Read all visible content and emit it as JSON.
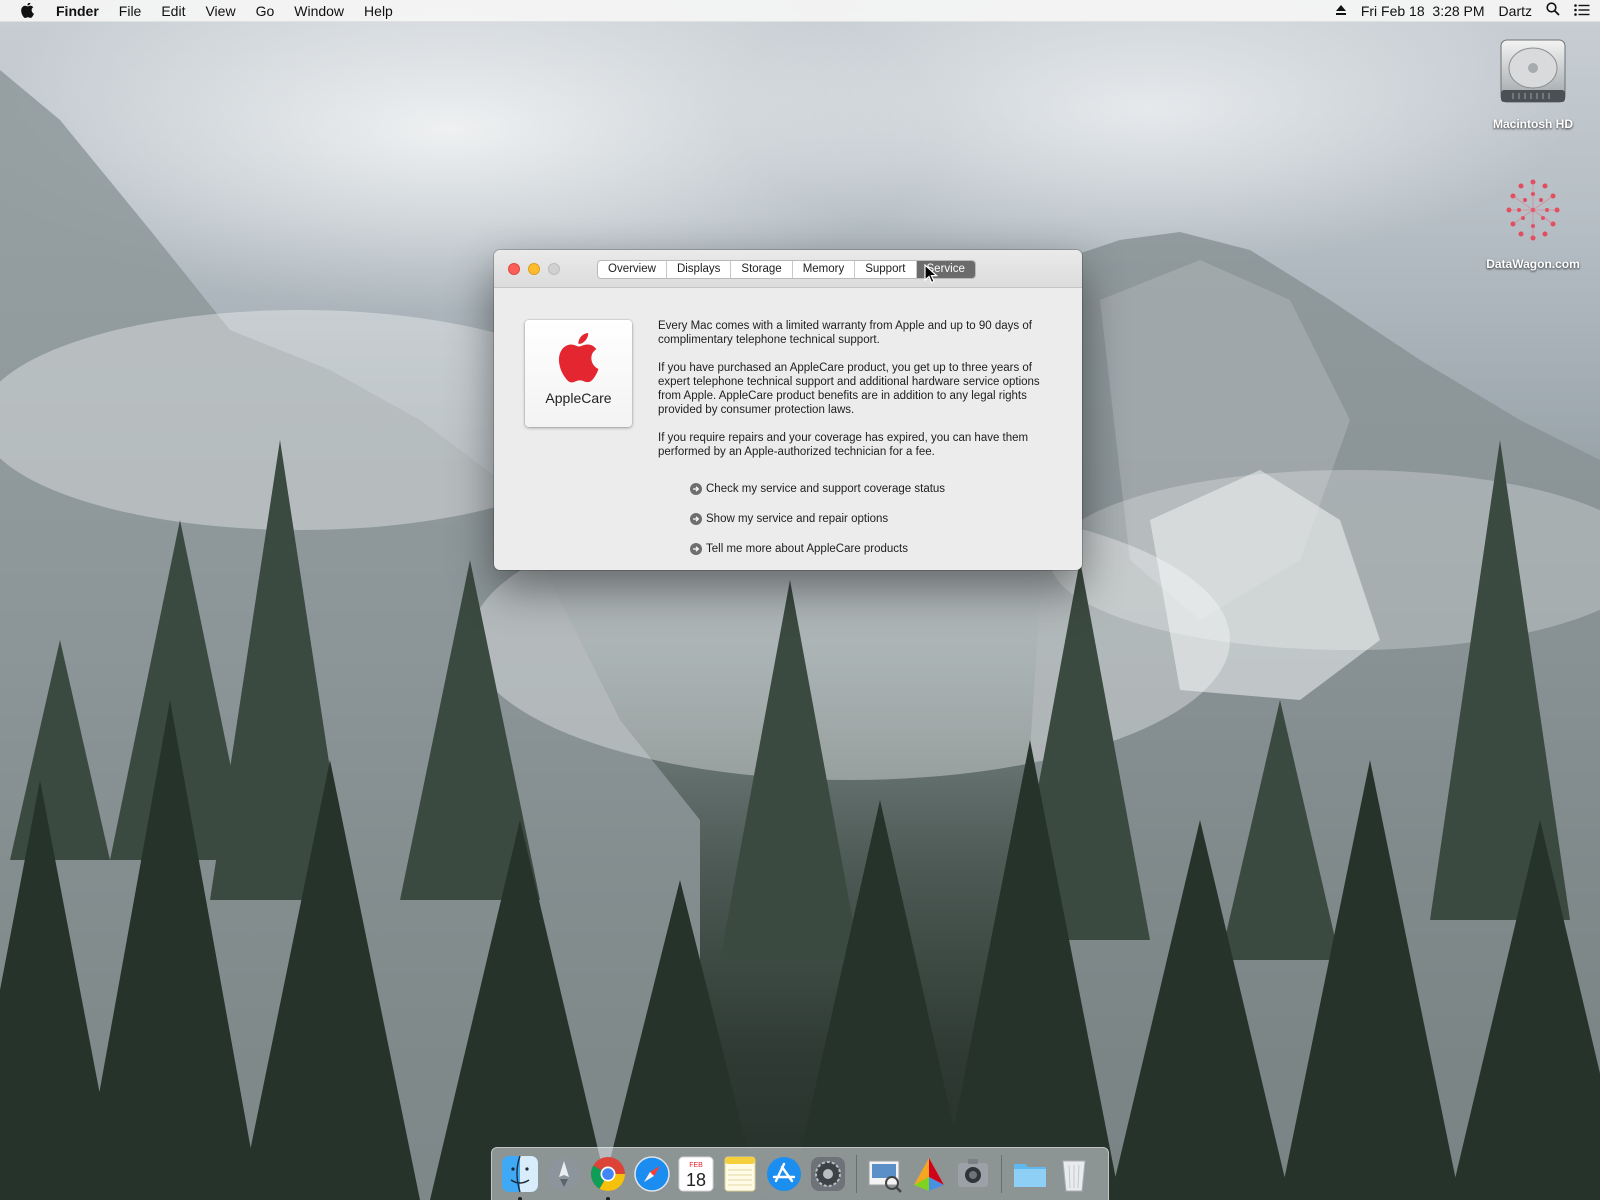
{
  "menubar": {
    "app_name": "Finder",
    "items": [
      "File",
      "Edit",
      "View",
      "Go",
      "Window",
      "Help"
    ],
    "datetime": "Fri Feb 18  3:28 PM",
    "user": "Dartz"
  },
  "desktop": {
    "icons": [
      {
        "label": "Macintosh HD",
        "icon": "hard-drive-icon"
      },
      {
        "label": "DataWagon.com",
        "icon": "datawagon-logo-icon"
      }
    ]
  },
  "window": {
    "tabs": [
      "Overview",
      "Displays",
      "Storage",
      "Memory",
      "Support",
      "Service"
    ],
    "active_tab": "Service",
    "applecare_label": "AppleCare",
    "paragraphs": [
      "Every Mac comes with a limited warranty from Apple and up to 90 days of complimentary telephone technical support.",
      "If you have purchased an AppleCare product, you get up to three years of expert telephone technical support and additional hardware service options from Apple. AppleCare product benefits are in addition to any legal rights provided by consumer protection laws.",
      "If you require repairs and your coverage has expired, you can have them performed by an Apple-authorized technician for a fee."
    ],
    "links": [
      "Check my service and support coverage status",
      "Show my service and repair options",
      "Tell me more about AppleCare products"
    ]
  },
  "dock": {
    "calendar_month": "FEB",
    "calendar_day": "18",
    "apps": [
      "finder-icon",
      "launchpad-icon",
      "chrome-icon",
      "safari-icon",
      "calendar-icon",
      "notes-icon",
      "app-store-icon",
      "system-preferences-icon",
      "preview-icon",
      "colorsync-icon",
      "screenshot-utility-icon",
      "downloads-folder-icon",
      "trash-icon"
    ]
  },
  "colors": {
    "close": "#fc5f57",
    "minimize": "#fdbc2e",
    "zoom": "#d0d0d0",
    "apple_red": "#e3262f",
    "active_tab": "#6b6b6b"
  }
}
